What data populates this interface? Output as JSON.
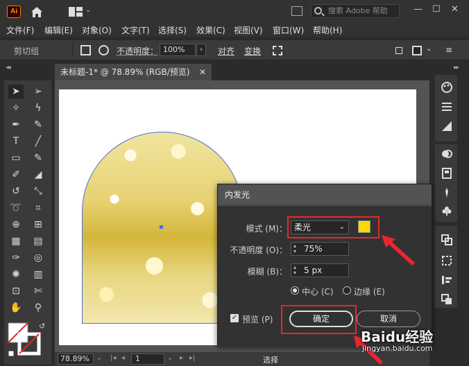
{
  "app": {
    "logo": "Ai",
    "search_placeholder": "搜索 Adobe 帮助",
    "window_controls": [
      "—",
      "☐",
      "✕"
    ]
  },
  "menu": [
    "文件(F)",
    "编辑(E)",
    "对象(O)",
    "文字(T)",
    "选择(S)",
    "效果(C)",
    "视图(V)",
    "窗口(W)",
    "帮助(H)"
  ],
  "control_bar": {
    "group_label": "剪切组",
    "opacity_label": "不透明度：",
    "opacity_value": "100%",
    "align_label": "对齐",
    "transform_label": "变换"
  },
  "document": {
    "tab_title": "未标题-1* @ 78.89% (RGB/预览)",
    "tab_close": "✕"
  },
  "status_bar": {
    "zoom": "78.89%",
    "page": "1",
    "status": "选择"
  },
  "dialog": {
    "title": "内发光",
    "mode_label": "模式 (M)：",
    "mode_value": "柔光",
    "mode_color": "#ffd800",
    "opacity_label": "不透明度 (O)：",
    "opacity_value": "75%",
    "blur_label": "模糊 (B)：",
    "blur_value": "5 px",
    "center_label": "中心 (C)",
    "edge_label": "边缘 (E)",
    "center_selected": true,
    "preview_label": "预览 (P)",
    "preview_checked": true,
    "ok_label": "确定",
    "cancel_label": "取消"
  },
  "watermark": {
    "brand": "Baidu经验",
    "url": "jingyan.baidu.com"
  },
  "colors": {
    "annotation_red": "#e8262f",
    "panel_dark": "#323232",
    "swatch_yellow": "#ffd800"
  }
}
